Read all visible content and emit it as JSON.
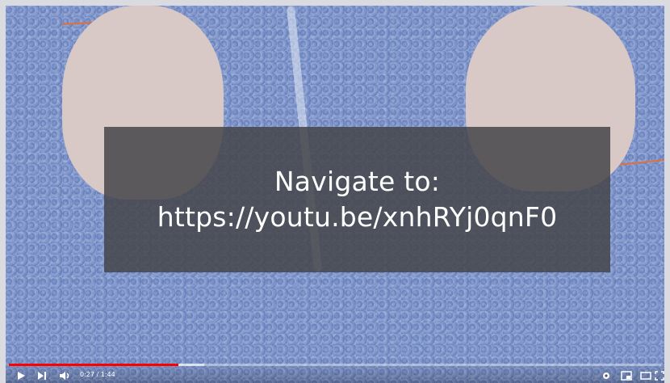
{
  "overlay": {
    "line1": "Navigate to:",
    "line2": "https://youtu.be/xnhRYj0qnF0"
  },
  "player": {
    "current_time": "0:27",
    "duration": "1:44",
    "time_display": "0:27 / 1:44",
    "played_fraction": 0.26,
    "buffered_fraction": 0.3,
    "accent_color": "#ff0000",
    "icons": [
      "play-icon",
      "next-icon",
      "volume-icon",
      "settings-icon",
      "miniplayer-icon",
      "theater-icon",
      "fullscreen-icon"
    ]
  }
}
